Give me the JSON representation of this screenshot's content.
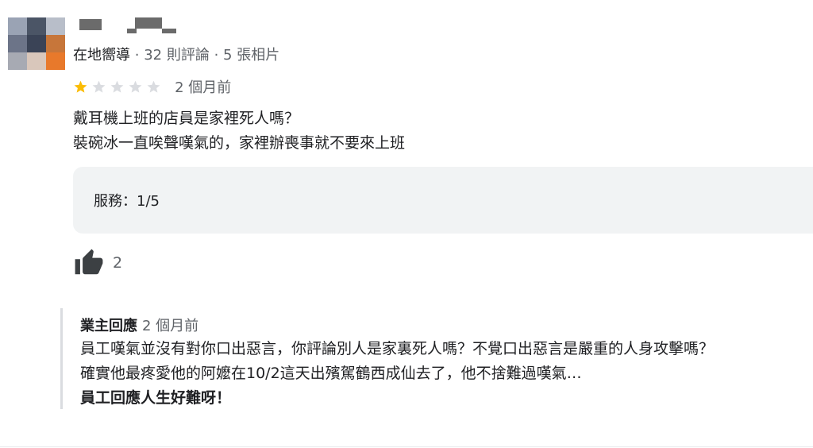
{
  "reviewer": {
    "badge": "在地嚮導",
    "reviews": "32 則評論",
    "photos": "5 張相片",
    "separator": "·"
  },
  "rating": {
    "value": 1,
    "max": 5,
    "time": "2 個月前",
    "filled_color": "#fbbc04",
    "empty_color": "#dadce0"
  },
  "review": {
    "lines": [
      "戴耳機上班的店員是家裡死人嗎？",
      "裝碗冰一直唉聲嘆氣的，家裡辦喪事就不要來上班"
    ]
  },
  "attributes": {
    "service_label": "服務：",
    "service_value": "1/5"
  },
  "likes": {
    "count": "2",
    "icon": "thumb-up-icon"
  },
  "owner_reply": {
    "title": "業主回應",
    "time": "2 個月前",
    "lines": [
      "員工嘆氣並沒有對你口出惡言，你評論別人是家裏死人嗎？不覺口出惡言是嚴重的人身攻擊嗎？",
      "確實他最疼愛他的阿嬤在10/2這天出殯駕鶴西成仙去了，他不捨難過嘆氣…",
      "員工回應人生好難呀！"
    ]
  }
}
